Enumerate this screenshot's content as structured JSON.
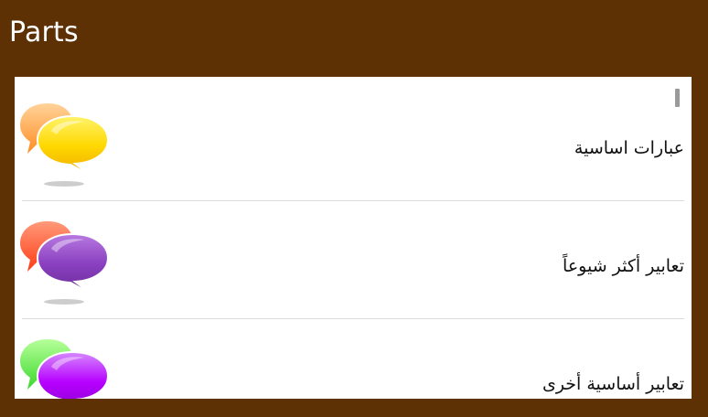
{
  "header": {
    "title": "Parts",
    "background_color": "#5e3104"
  },
  "list": {
    "items": [
      {
        "label": "عبارات اساسية",
        "icon": "speech-bubbles-icon",
        "back_color": "#ffa24a",
        "front_color": "#ffd800"
      },
      {
        "label": "تعابير أكثر شيوعاً",
        "icon": "speech-bubbles-icon",
        "back_color": "#ff5a36",
        "front_color": "#8a3fc0"
      },
      {
        "label": "تعابير أساسية أخرى",
        "icon": "speech-bubbles-icon",
        "back_color": "#5cff4a",
        "front_color": "#b700ff"
      }
    ]
  }
}
